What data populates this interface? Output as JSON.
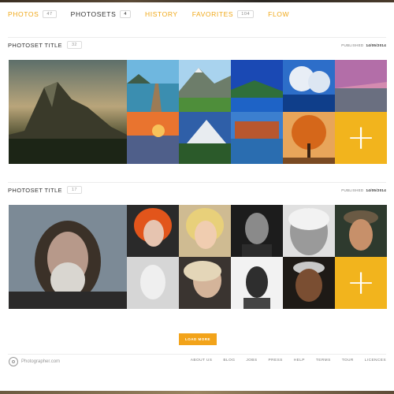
{
  "tabs": [
    {
      "label": "PHOTOS",
      "count": "47",
      "active": false
    },
    {
      "label": "PHOTOSETS",
      "count": "4",
      "active": true
    },
    {
      "label": "HISTORY",
      "active": false
    },
    {
      "label": "FAVORITES",
      "count": "104",
      "active": false
    },
    {
      "label": "FLOW",
      "active": false
    }
  ],
  "photosets": [
    {
      "title": "PHOTOSET TITLE",
      "count": "32",
      "published_label": "PUBLISHED",
      "published_date": "14/05/2014",
      "cover": "mountain-sunset-photo",
      "photos": [
        "pier-lake-photo",
        "alpine-lake-photo",
        "mountain-river-photo",
        "frozen-trees-photo",
        "pink-shore-photo",
        "sunset-sea-photo",
        "snow-mountain-photo",
        "canyon-lake-photo",
        "orange-tree-photo"
      ]
    },
    {
      "title": "PHOTOSET TITLE",
      "count": "17",
      "published_label": "PUBLISHED",
      "published_date": "14/05/2014",
      "cover": "old-man-snow-portrait",
      "photos": [
        "redhead-woman-portrait",
        "blonde-woman-portrait",
        "man-bw-portrait",
        "elderly-bw-portrait",
        "boy-cap-portrait",
        "pale-child-portrait",
        "woman-short-hair-portrait",
        "woman-bw-portrait",
        "elder-hands-portrait"
      ]
    }
  ],
  "load_more": "LOAD MORE",
  "footer": {
    "logo_text": "Photographer.com",
    "links": [
      "ABOUT US",
      "BLOG",
      "JOBS",
      "PRESS",
      "HELP",
      "TERMS",
      "TOUR",
      "LICENCES"
    ]
  },
  "colors": {
    "accent": "#f2b41d",
    "button": "#f2a31a"
  }
}
